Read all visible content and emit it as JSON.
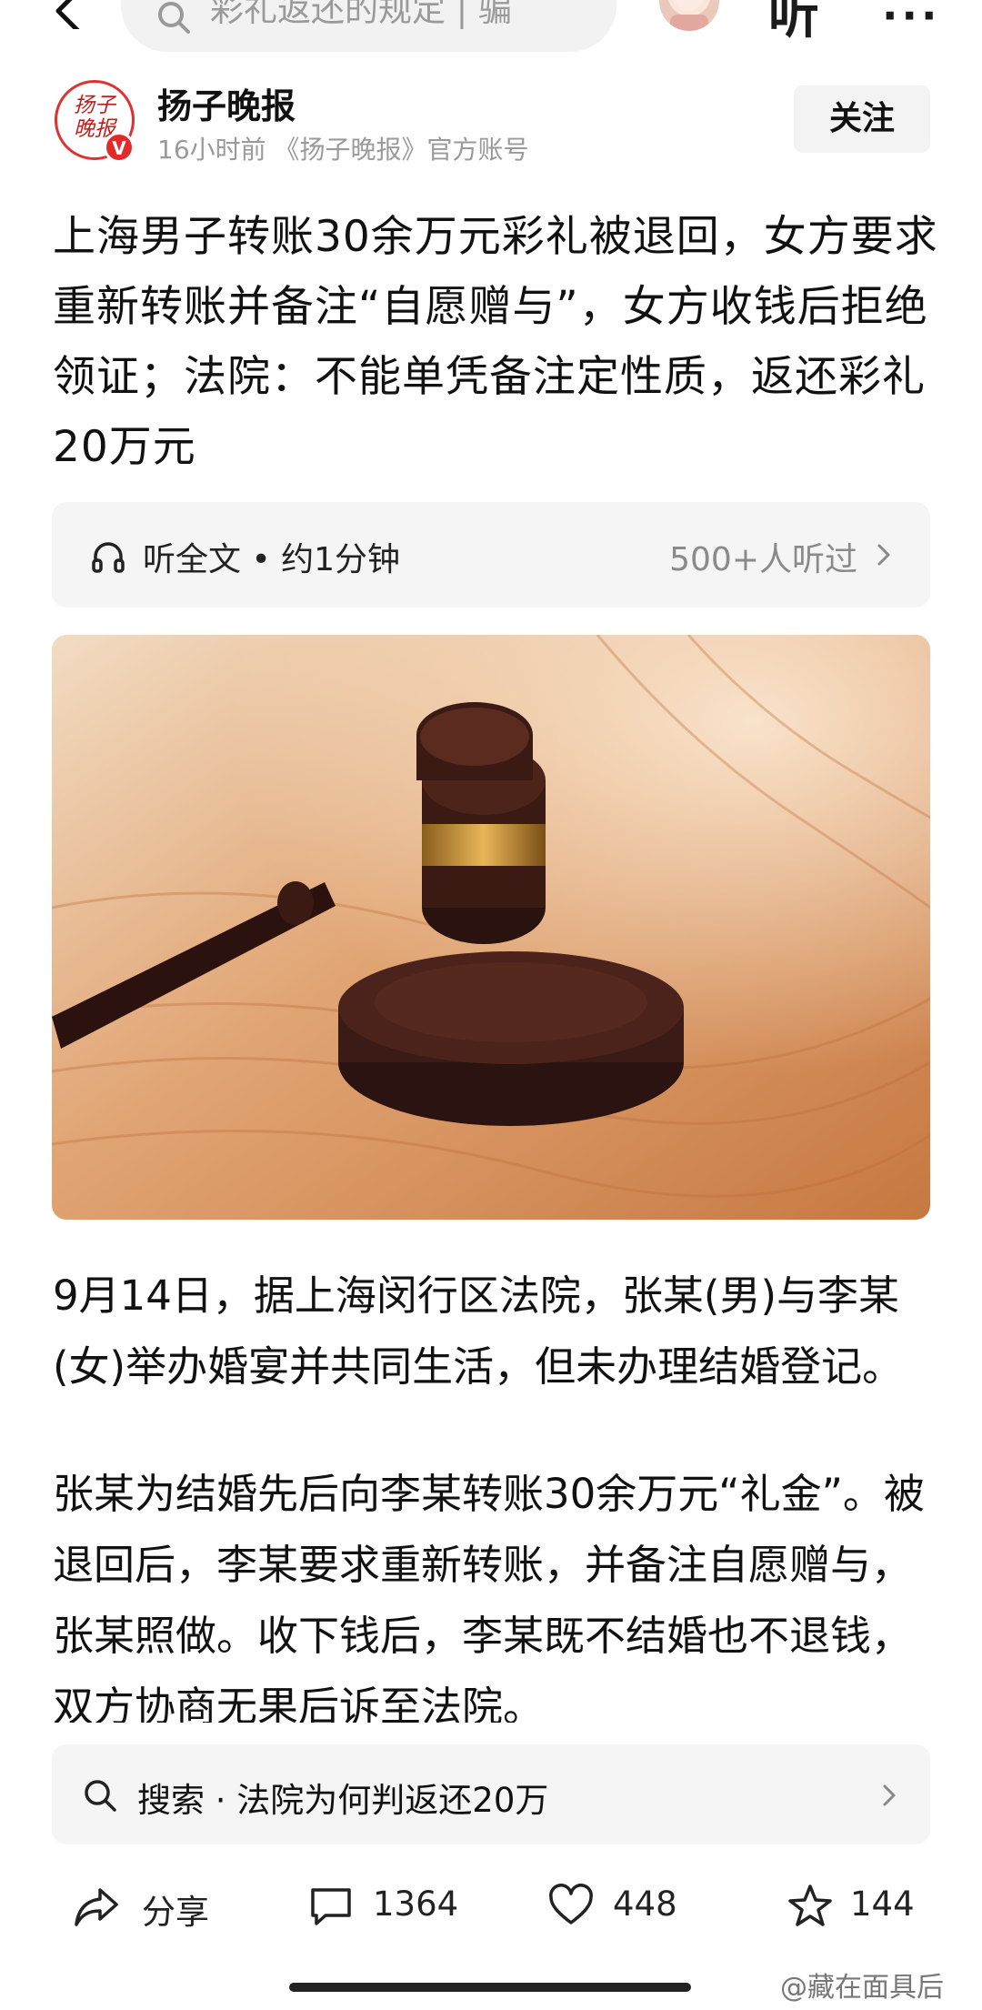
{
  "topbar": {
    "search_placeholder": "彩礼返还的规定 | 骗",
    "listen_label": "听",
    "more_label": "···"
  },
  "author": {
    "logo_text": "扬子晚报",
    "verified_mark": "V",
    "name": "扬子晚报",
    "meta": "16小时前  《扬子晚报》官方账号",
    "follow_label": "关注"
  },
  "article": {
    "headline": "上海男子转账30余万元彩礼被退回，女方要求重新转账并备注“自愿赠与”，女方收钱后拒绝领证；法院：不能单凭备注定性质，返还彩礼20万元",
    "listen_bar": {
      "text": "听全文 • 约1分钟",
      "count": "500+人听过"
    },
    "paragraphs": [
      "9月14日，据上海闵行区法院，张某(男)与李某(女)举办婚宴并共同生活，但未办理结婚登记。",
      "张某为结婚先后向李某转账30余万元“礼金”。被退回后，李某要求重新转账，并备注自愿赠与，张某照做。收下钱后，李某既不结婚也不退钱，双方协商无果后诉至法院。"
    ]
  },
  "suggest": {
    "text": "搜索 · 法院为何判返还20万"
  },
  "actions": {
    "share_label": "分享",
    "comment_count": "1364",
    "like_count": "448",
    "favorite_count": "144"
  },
  "watermark": "@藏在面具后",
  "colors": {
    "accent_red": "#e02b2b",
    "gray_text": "#9a9a9a",
    "panel_bg": "#f5f5f6"
  }
}
